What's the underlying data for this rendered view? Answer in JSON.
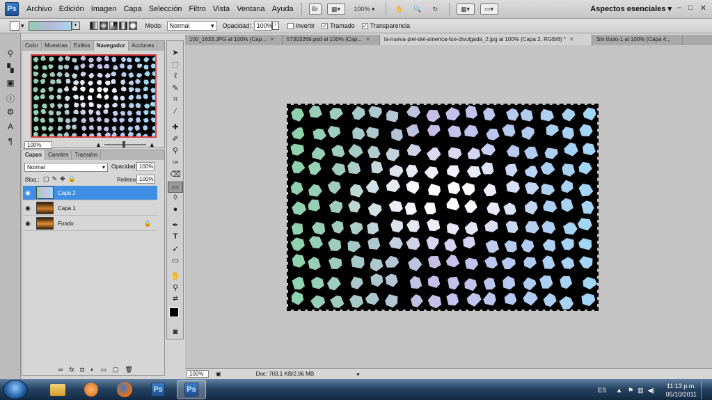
{
  "app": {
    "logo": "Ps",
    "workspace": "Aspectos esenciales ▾",
    "zoom": "100%"
  },
  "menu": [
    "Archivo",
    "Edición",
    "Imagen",
    "Capa",
    "Selección",
    "Filtro",
    "Vista",
    "Ventana",
    "Ayuda"
  ],
  "menubar_icons": [
    "Br",
    "▦▾",
    "100% ▾",
    "✋",
    "🔍",
    "↻",
    "▦▾",
    "▭▾"
  ],
  "window_buttons": [
    "–",
    "□",
    "✕"
  ],
  "options": {
    "mode_label": "Modo:",
    "mode_value": "Normal",
    "opacity_label": "Opacidad:",
    "opacity_value": "100%",
    "invert_label": "Invertir",
    "dither_label": "Tramado",
    "transparency_label": "Transparencia"
  },
  "nav_panel": {
    "tabs": [
      "Color",
      "Muestras",
      "Estilos",
      "Navegador",
      "Acciones"
    ],
    "active": "Navegador",
    "zoom": "100%"
  },
  "layers_panel": {
    "tabs": [
      "Capas",
      "Canales",
      "Trazados"
    ],
    "blend_mode": "Normal",
    "opacity_label": "Opacidad:",
    "opacity_value": "100%",
    "lock_label": "Bloq.:",
    "fill_label": "Relleno:",
    "fill_value": "100%",
    "layers": [
      {
        "name": "Capa 2",
        "selected": true
      },
      {
        "name": "Capa 1",
        "selected": false
      },
      {
        "name": "Fondo",
        "selected": false
      }
    ],
    "footer_icons": [
      "∞",
      "fx",
      "◘",
      "◐",
      "▭",
      "▢",
      "🗑"
    ]
  },
  "doc_tabs": [
    {
      "label": "100_1633.JPG al 100% (Cap...",
      "active": false
    },
    {
      "label": "57303269.psd al 100% (Cap...",
      "active": false
    },
    {
      "label": "la-nueva-piel-del-america-fue-divulgada_2.jpg al 100% (Capa 2, RGB/8) *",
      "active": true
    },
    {
      "label": "Sin título-1 al 100% (Capa 4...",
      "active": false
    }
  ],
  "status": {
    "zoom": "100%",
    "doc": "Doc: 703.1 KB/2.06 MB"
  },
  "taskbar": {
    "lang": "ES",
    "time": "11:13 p.m.",
    "date": "05/10/2011"
  },
  "colors": {
    "selection": "#3e8fe3",
    "accent": "#1d4f8e"
  }
}
